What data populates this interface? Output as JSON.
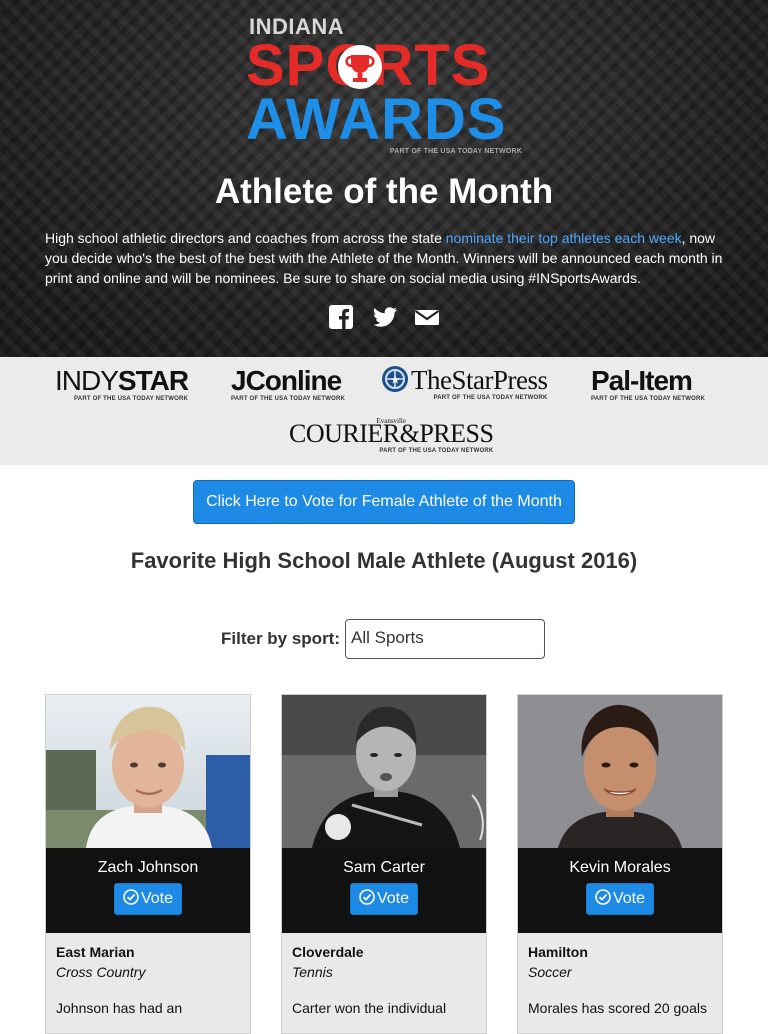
{
  "logo": {
    "top": "INDIANA",
    "line1": "SPORTS",
    "line2": "AWARDS",
    "network": "PART OF THE USA TODAY NETWORK",
    "colors": {
      "red": "#e52b27",
      "blue": "#1e8fe8"
    }
  },
  "hero": {
    "title": "Athlete of the Month",
    "desc_pre": "High school athletic directors and coaches from across the state ",
    "desc_link": "nominate their top athletes each week",
    "desc_post": ", now you decide who's the best of the best with the Athlete of the Month. Winners will be announced each month in print and online and will be nominees. Be sure to share on social media using #INSportsAwards.",
    "social": [
      "facebook-icon",
      "twitter-icon",
      "email-icon"
    ]
  },
  "partners": {
    "indystar": {
      "light": "INDY",
      "bold": "STAR",
      "sub": "PART OF THE USA TODAY NETWORK"
    },
    "jconline": {
      "name": "JConline",
      "sub": "PART OF THE USA TODAY NETWORK"
    },
    "starpress": {
      "name": "TheStarPress",
      "sub": "PART OF THE USA TODAY NETWORK"
    },
    "palitem": {
      "name": "Pal-Item",
      "sub": "PART OF THE USA TODAY NETWORK"
    },
    "courier": {
      "small": "Evansville",
      "name": "COURIER&PRESS",
      "sub": "PART OF THE USA TODAY NETWORK"
    }
  },
  "cta": {
    "label": "Click Here to Vote for Female Athlete of the Month",
    "color": "#1d8ae5"
  },
  "section_title": "Favorite High School Male Athlete (August 2016)",
  "filter": {
    "label": "Filter by sport:",
    "value": "All Sports"
  },
  "vote_label": "Vote",
  "athletes": [
    {
      "name": "Zach Johnson",
      "school": "East Marian",
      "sport": "Cross Country",
      "blurb": "Johnson has had an"
    },
    {
      "name": "Sam Carter",
      "school": "Cloverdale",
      "sport": "Tennis",
      "blurb": "Carter won the individual"
    },
    {
      "name": "Kevin Morales",
      "school": "Hamilton",
      "sport": "Soccer",
      "blurb": "Morales has scored 20 goals"
    }
  ]
}
